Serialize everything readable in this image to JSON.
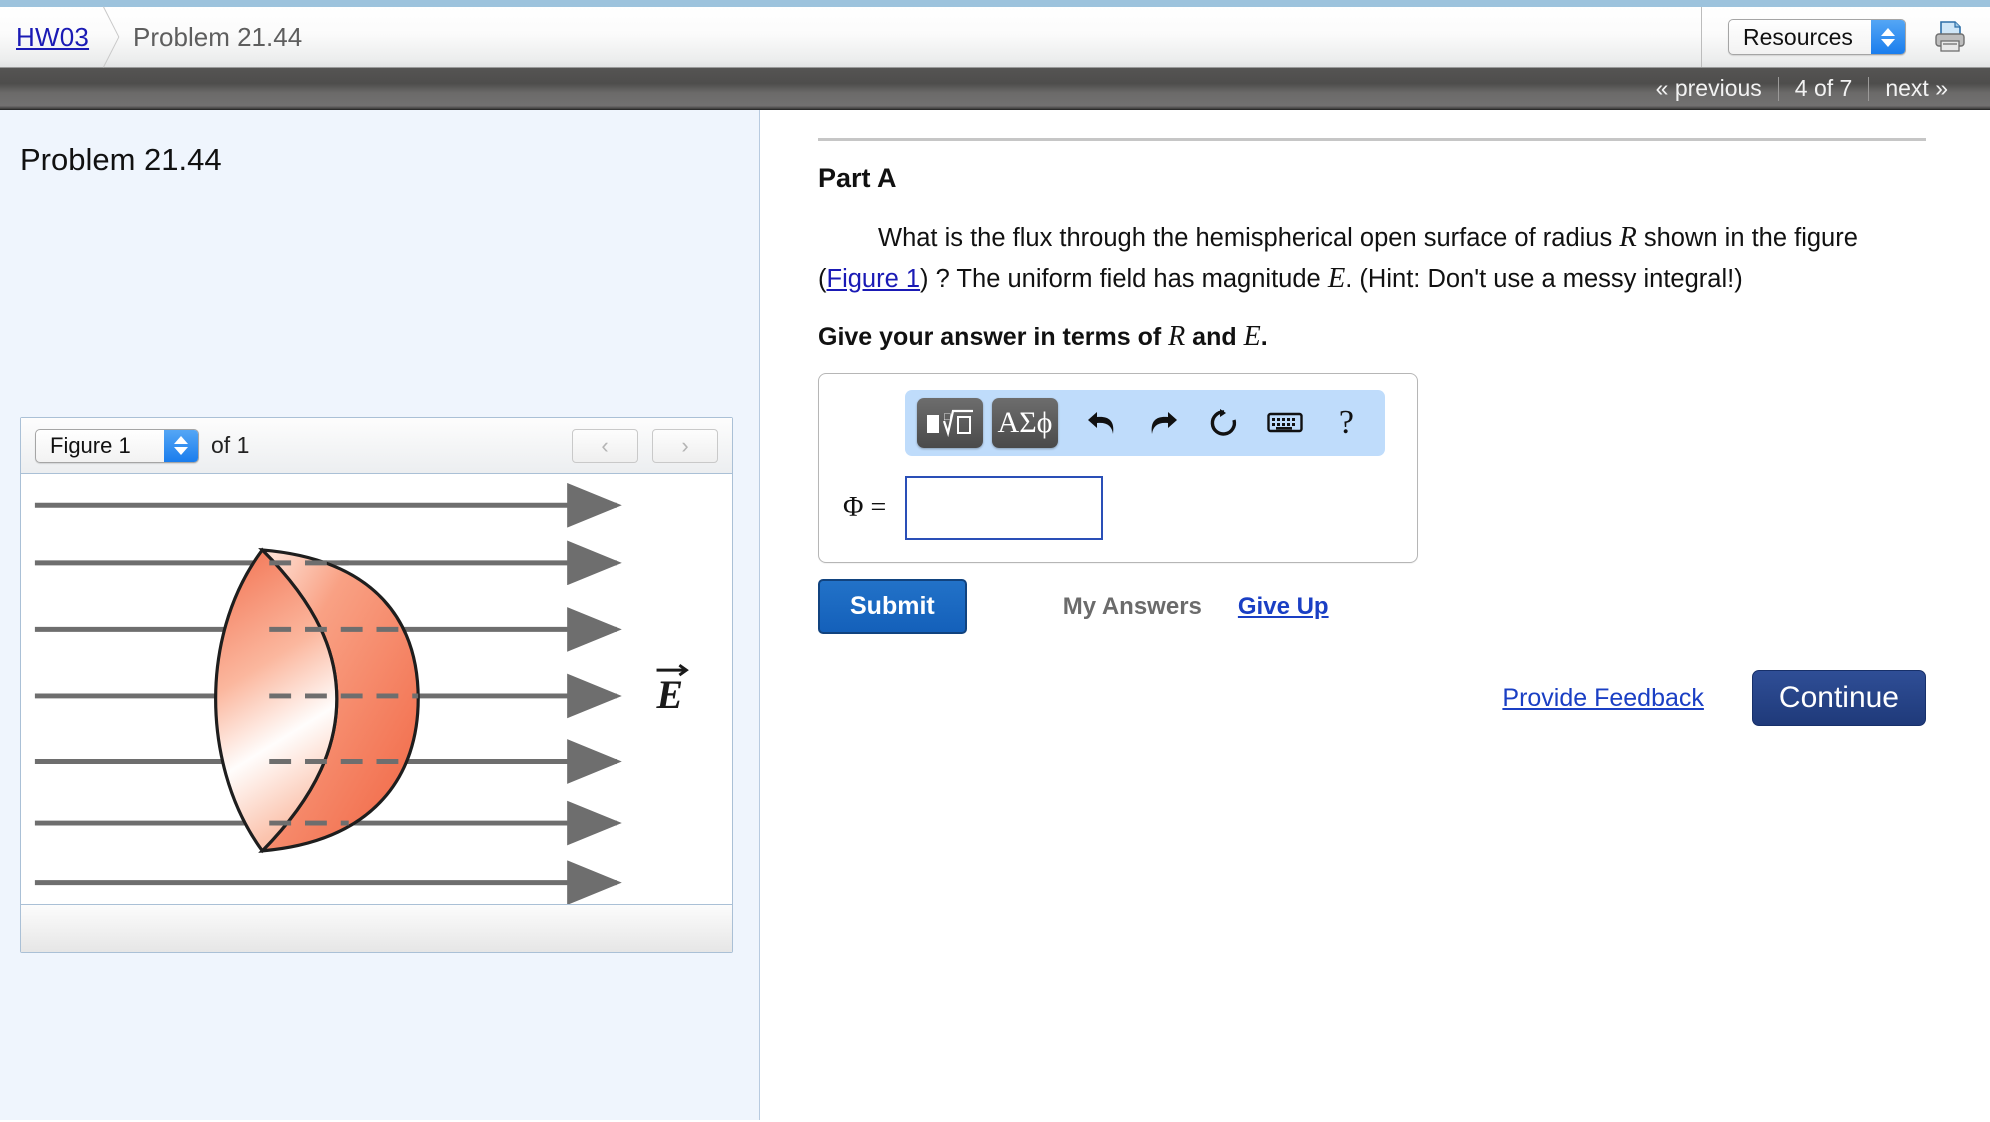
{
  "header": {
    "breadcrumb": {
      "home_label": "HW03",
      "current_label": "Problem 21.44"
    },
    "resources_select": {
      "value": "Resources"
    },
    "print_icon": "printer-icon"
  },
  "nav": {
    "previous_label": "« previous",
    "position_label": "4 of 7",
    "next_label": "next »"
  },
  "left_panel": {
    "title": "Problem 21.44",
    "figure_widget": {
      "select_value": "Figure 1",
      "of_label": "of 1",
      "prev_label": "‹",
      "next_label": "›"
    }
  },
  "main": {
    "part_label": "Part A",
    "question": {
      "segment_1": "What is the flux through the hemispherical open surface of radius ",
      "var_R": "R",
      "segment_2": " shown in the figure (",
      "figure_link": "Figure 1",
      "segment_3": ") ? The uniform field has magnitude ",
      "var_E": "E",
      "segment_4": ". (Hint: Don't use a messy integral!)"
    },
    "instruction": {
      "segment_1": "Give your answer in terms of ",
      "var_R": "R",
      "segment_2": " and ",
      "var_E": "E",
      "segment_3": "."
    },
    "toolbar": {
      "template_button": "template-root-icon",
      "greek_button": "ΑΣϕ",
      "undo_icon": "undo-icon",
      "redo_icon": "redo-icon",
      "reset_icon": "reset-icon",
      "keyboard_icon": "keyboard-icon",
      "help_label": "?"
    },
    "answer": {
      "symbol_label": "Φ =",
      "input_value": "",
      "input_placeholder": ""
    },
    "submit_label": "Submit",
    "my_answers_label": "My Answers",
    "give_up_label": "Give Up",
    "provide_feedback_label": "Provide Feedback",
    "continue_label": "Continue"
  },
  "figure": {
    "field_label": "E",
    "field_line_count": 7,
    "surface_name": "hemispherical-open-surface"
  },
  "colors": {
    "link": "#1a1ab5",
    "accent_blue": "#1460ba",
    "continue_navy": "#2f4e96",
    "toolbar_panel": "#bfdcfb",
    "left_panel_bg": "#eff5fd",
    "surface_orange": "#f4795b"
  }
}
